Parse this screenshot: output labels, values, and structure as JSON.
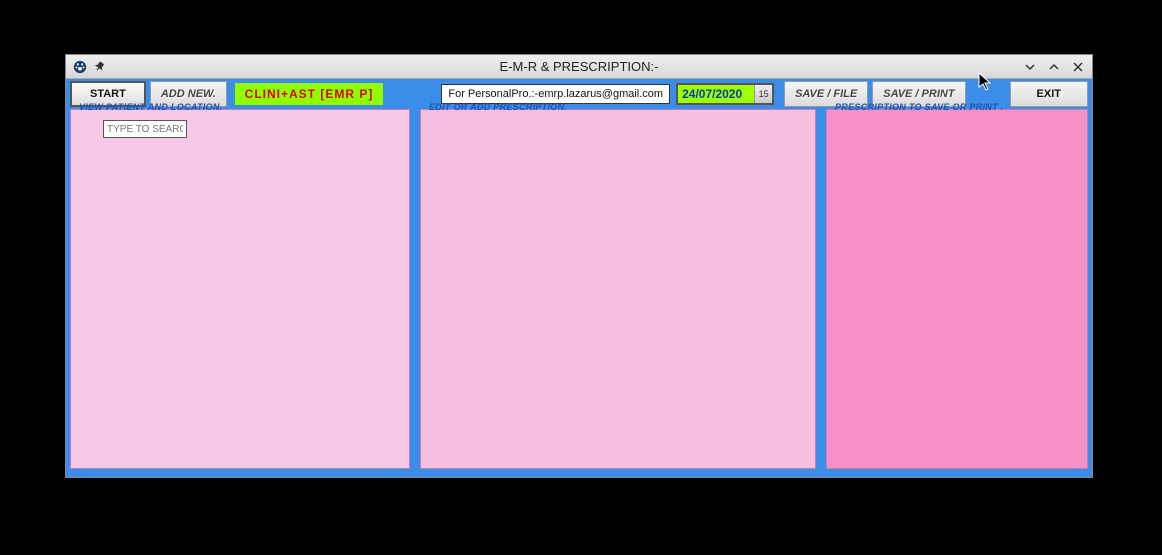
{
  "window": {
    "title": "E-M-R & PRESCRIPTION:-"
  },
  "toolbar": {
    "start_label": "START",
    "add_new_label": "ADD NEW.",
    "brand_label": "CLINI+AST [EMR P]",
    "license_label": "For PersonalPro.:-emrp.lazarus@gmail.com",
    "date_value": "24/07/2020",
    "date_picker_badge": "15",
    "save_file_label": "SAVE / FILE",
    "save_print_label": "SAVE / PRINT",
    "exit_label": "EXIT"
  },
  "panels": {
    "left": {
      "title": "VIEW PATIENT AND LOCATION.",
      "search_placeholder": "TYPE TO SEARCH"
    },
    "mid": {
      "title": "EDIT OR ADD PRESCRIPTION."
    },
    "right": {
      "title": "PRESCRIPTION TO SAVE OR PRINT ."
    }
  }
}
